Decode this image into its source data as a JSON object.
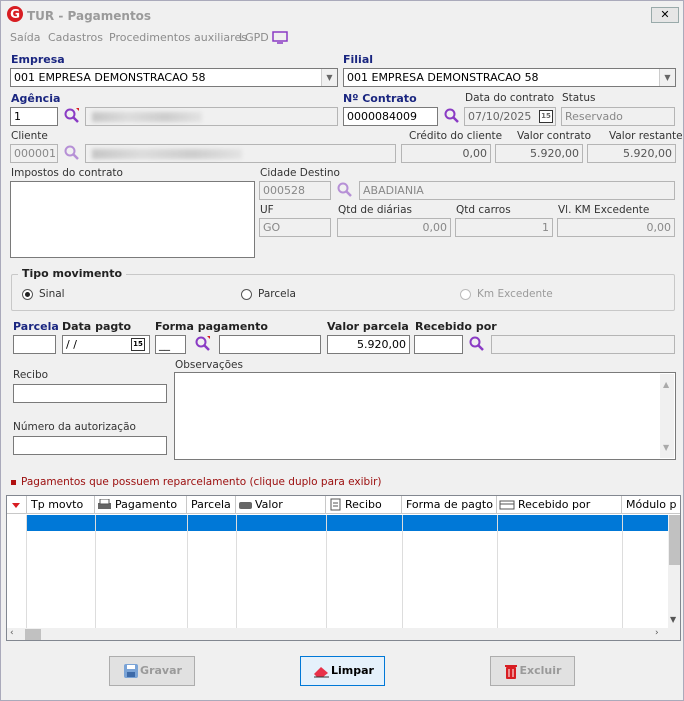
{
  "window": {
    "title": "TUR - Pagamentos",
    "close": "✕",
    "app_icon": "G"
  },
  "menu": {
    "items": [
      "Saída",
      "Cadastros",
      "Procedimentos auxiliares",
      "LGPD"
    ]
  },
  "empresa": {
    "label": "Empresa",
    "value": "001 EMPRESA DEMONSTRACAO 58"
  },
  "filial": {
    "label": "Filial",
    "value": "001 EMPRESA DEMONSTRACAO 58"
  },
  "agencia": {
    "label": "Agência",
    "value": "1"
  },
  "contrato": {
    "label": "Nº Contrato",
    "value": "0000084009"
  },
  "data_contrato": {
    "label": "Data do contrato",
    "value": "07/10/2025"
  },
  "status": {
    "label": "Status",
    "value": "Reservado"
  },
  "cliente": {
    "label": "Cliente",
    "value": "000001"
  },
  "credito": {
    "label": "Crédito do cliente",
    "value": "0,00"
  },
  "valor_contrato": {
    "label": "Valor contrato",
    "value": "5.920,00"
  },
  "valor_restante": {
    "label": "Valor restante",
    "value": "5.920,00"
  },
  "impostos": {
    "label": "Impostos do contrato"
  },
  "cidade": {
    "label": "Cidade Destino",
    "code": "000528",
    "name": "ABADIANIA"
  },
  "uf": {
    "label": "UF",
    "value": "GO"
  },
  "diarias": {
    "label": "Qtd de diárias",
    "value": "0,00"
  },
  "carros": {
    "label": "Qtd carros",
    "value": "1"
  },
  "km": {
    "label": "Vl. KM Excedente",
    "value": "0,00"
  },
  "tipo": {
    "label": "Tipo movimento",
    "sinal": "Sinal",
    "parcela": "Parcela",
    "km": "Km Excedente"
  },
  "pag": {
    "parcela": "Parcela",
    "data": "Data pagto",
    "data_value": " /  /",
    "forma": "Forma pagamento",
    "forma_value": "__",
    "valor": "Valor parcela",
    "valor_value": "5.920,00",
    "recebido": "Recebido por"
  },
  "recibo": {
    "label": "Recibo"
  },
  "autorizacao": {
    "label": "Número da autorização"
  },
  "obs": {
    "label": "Observações"
  },
  "reparc": {
    "label": "Pagamentos que possuem reparcelamento (clique duplo para exibir)"
  },
  "grid": {
    "columns": [
      "Tp movto",
      "Pagamento",
      "Parcela",
      "Valor",
      "Recibo",
      "Forma de pagto",
      "Recebido por",
      "Módulo p"
    ]
  },
  "buttons": {
    "gravar": "Gravar",
    "limpar": "Limpar",
    "excluir": "Excluir"
  },
  "colors": {
    "accent_label": "#1a2680",
    "red_icon": "#d81d22",
    "selection": "#0078d7",
    "magnifier": "#8a3bc4"
  }
}
